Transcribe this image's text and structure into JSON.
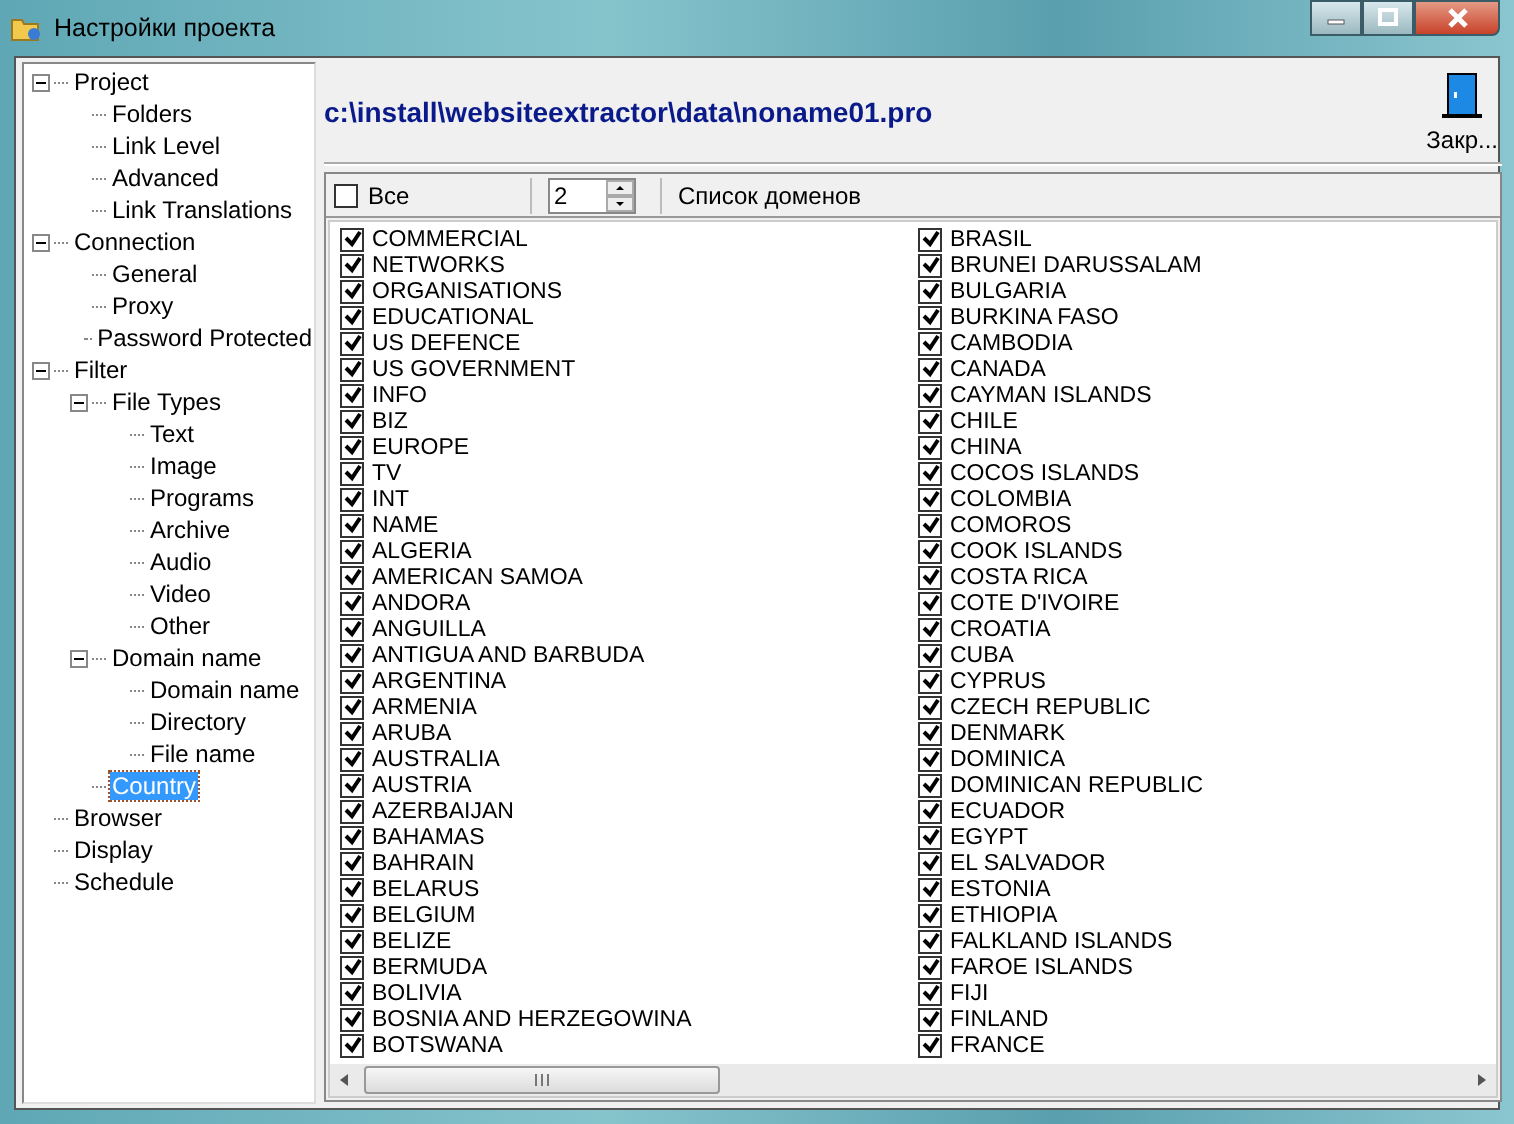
{
  "window": {
    "title": "Настройки проекта"
  },
  "tree": [
    {
      "label": "Project",
      "expanded": true,
      "selected": false,
      "children": [
        {
          "label": "Folders",
          "selected": false
        },
        {
          "label": "Link Level",
          "selected": false
        },
        {
          "label": "Advanced",
          "selected": false
        },
        {
          "label": "Link Translations",
          "selected": false
        }
      ]
    },
    {
      "label": "Connection",
      "expanded": true,
      "selected": false,
      "children": [
        {
          "label": "General",
          "selected": false
        },
        {
          "label": "Proxy",
          "selected": false
        },
        {
          "label": "Password Protected",
          "selected": false
        }
      ]
    },
    {
      "label": "Filter",
      "expanded": true,
      "selected": false,
      "children": [
        {
          "label": "File Types",
          "expanded": true,
          "selected": false,
          "children": [
            {
              "label": "Text",
              "selected": false
            },
            {
              "label": "Image",
              "selected": false
            },
            {
              "label": "Programs",
              "selected": false
            },
            {
              "label": "Archive",
              "selected": false
            },
            {
              "label": "Audio",
              "selected": false
            },
            {
              "label": "Video",
              "selected": false
            },
            {
              "label": "Other",
              "selected": false
            }
          ]
        },
        {
          "label": "Domain name",
          "expanded": true,
          "selected": false,
          "children": [
            {
              "label": "Domain name",
              "selected": false
            },
            {
              "label": "Directory",
              "selected": false
            },
            {
              "label": "File name",
              "selected": false
            }
          ]
        },
        {
          "label": "Country",
          "selected": true
        }
      ]
    },
    {
      "label": "Browser",
      "selected": false
    },
    {
      "label": "Display",
      "selected": false
    },
    {
      "label": "Schedule",
      "selected": false
    }
  ],
  "header": {
    "path": "c:\\install\\websiteextractor\\data\\noname01.pro",
    "close_label": "Закр..."
  },
  "toolbar": {
    "all_label": "Все",
    "all_checked": false,
    "level_value": "2",
    "list_label": "Список доменов"
  },
  "domains": [
    [
      {
        "name": "COMMERCIAL",
        "checked": true
      },
      {
        "name": "NETWORKS",
        "checked": true
      },
      {
        "name": "ORGANISATIONS",
        "checked": true
      },
      {
        "name": "EDUCATIONAL",
        "checked": true
      },
      {
        "name": "US DEFENCE",
        "checked": true
      },
      {
        "name": "US GOVERNMENT",
        "checked": true
      },
      {
        "name": "INFO",
        "checked": true
      },
      {
        "name": "BIZ",
        "checked": true
      },
      {
        "name": "EUROPE",
        "checked": true
      },
      {
        "name": "TV",
        "checked": true
      },
      {
        "name": "INT",
        "checked": true
      },
      {
        "name": "NAME",
        "checked": true
      },
      {
        "name": "ALGERIA",
        "checked": true
      },
      {
        "name": "AMERICAN SAMOA",
        "checked": true
      },
      {
        "name": "ANDORA",
        "checked": true
      },
      {
        "name": "ANGUILLA",
        "checked": true
      },
      {
        "name": "ANTIGUA AND BARBUDA",
        "checked": true
      },
      {
        "name": "ARGENTINA",
        "checked": true
      },
      {
        "name": "ARMENIA",
        "checked": true
      },
      {
        "name": "ARUBA",
        "checked": true
      },
      {
        "name": "AUSTRALIA",
        "checked": true
      },
      {
        "name": "AUSTRIA",
        "checked": true
      },
      {
        "name": "AZERBAIJAN",
        "checked": true
      },
      {
        "name": "BAHAMAS",
        "checked": true
      },
      {
        "name": "BAHRAIN",
        "checked": true
      },
      {
        "name": "BELARUS",
        "checked": true
      },
      {
        "name": "BELGIUM",
        "checked": true
      },
      {
        "name": "BELIZE",
        "checked": true
      },
      {
        "name": "BERMUDA",
        "checked": true
      },
      {
        "name": "BOLIVIA",
        "checked": true
      },
      {
        "name": "BOSNIA AND HERZEGOWINA",
        "checked": true
      },
      {
        "name": "BOTSWANA",
        "checked": true
      }
    ],
    [
      {
        "name": "BRASIL",
        "checked": true
      },
      {
        "name": "BRUNEI DARUSSALAM",
        "checked": true
      },
      {
        "name": "BULGARIA",
        "checked": true
      },
      {
        "name": "BURKINA FASO",
        "checked": true
      },
      {
        "name": "CAMBODIA",
        "checked": true
      },
      {
        "name": "CANADA",
        "checked": true
      },
      {
        "name": "CAYMAN ISLANDS",
        "checked": true
      },
      {
        "name": "CHILE",
        "checked": true
      },
      {
        "name": "CHINA",
        "checked": true
      },
      {
        "name": "COCOS ISLANDS",
        "checked": true
      },
      {
        "name": "COLOMBIA",
        "checked": true
      },
      {
        "name": "COMOROS",
        "checked": true
      },
      {
        "name": "COOK ISLANDS",
        "checked": true
      },
      {
        "name": "COSTA RICA",
        "checked": true
      },
      {
        "name": "COTE D'IVOIRE",
        "checked": true
      },
      {
        "name": "CROATIA",
        "checked": true
      },
      {
        "name": "CUBA",
        "checked": true
      },
      {
        "name": "CYPRUS",
        "checked": true
      },
      {
        "name": "CZECH REPUBLIC",
        "checked": true
      },
      {
        "name": "DENMARK",
        "checked": true
      },
      {
        "name": "DOMINICA",
        "checked": true
      },
      {
        "name": "DOMINICAN REPUBLIC",
        "checked": true
      },
      {
        "name": "ECUADOR",
        "checked": true
      },
      {
        "name": "EGYPT",
        "checked": true
      },
      {
        "name": "EL SALVADOR",
        "checked": true
      },
      {
        "name": "ESTONIA",
        "checked": true
      },
      {
        "name": "ETHIOPIA",
        "checked": true
      },
      {
        "name": "FALKLAND ISLANDS",
        "checked": true
      },
      {
        "name": "FAROE ISLANDS",
        "checked": true
      },
      {
        "name": "FIJI",
        "checked": true
      },
      {
        "name": "FINLAND",
        "checked": true
      },
      {
        "name": "FRANCE",
        "checked": true
      }
    ]
  ]
}
